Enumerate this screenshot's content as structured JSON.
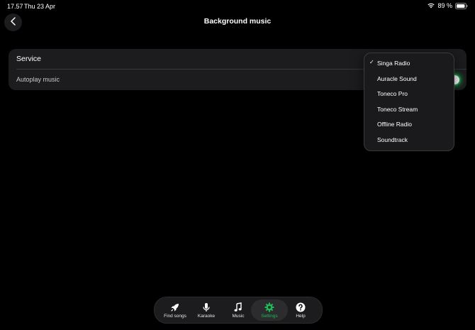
{
  "status_bar": {
    "time": "17.57",
    "date": "Thu 23 Apr",
    "battery": "89 %"
  },
  "header": {
    "title": "Background music",
    "back_icon": "chevron-left-icon"
  },
  "settings": {
    "service_label": "Service",
    "autoplay_label": "Autoplay music",
    "autoplay_on": true
  },
  "dropdown": {
    "check_mark": "✓",
    "selected_index": 0,
    "items": [
      {
        "label": "Singa Radio"
      },
      {
        "label": "Auracle Sound"
      },
      {
        "label": "Toneco Pro"
      },
      {
        "label": "Toneco Stream"
      },
      {
        "label": "Offline Radio"
      },
      {
        "label": "Soundtrack"
      }
    ]
  },
  "tab_bar": {
    "active_index": 3,
    "tabs": [
      {
        "label": "Find songs",
        "icon": "rocket-icon"
      },
      {
        "label": "Karaoke",
        "icon": "microphone-icon"
      },
      {
        "label": "Music",
        "icon": "music-note-icon"
      },
      {
        "label": "Settings",
        "icon": "gear-icon"
      },
      {
        "label": "Help",
        "icon": "help-icon"
      }
    ]
  },
  "colors": {
    "accent": "#1db954",
    "background": "#000000",
    "card": "#1c1c1e"
  }
}
